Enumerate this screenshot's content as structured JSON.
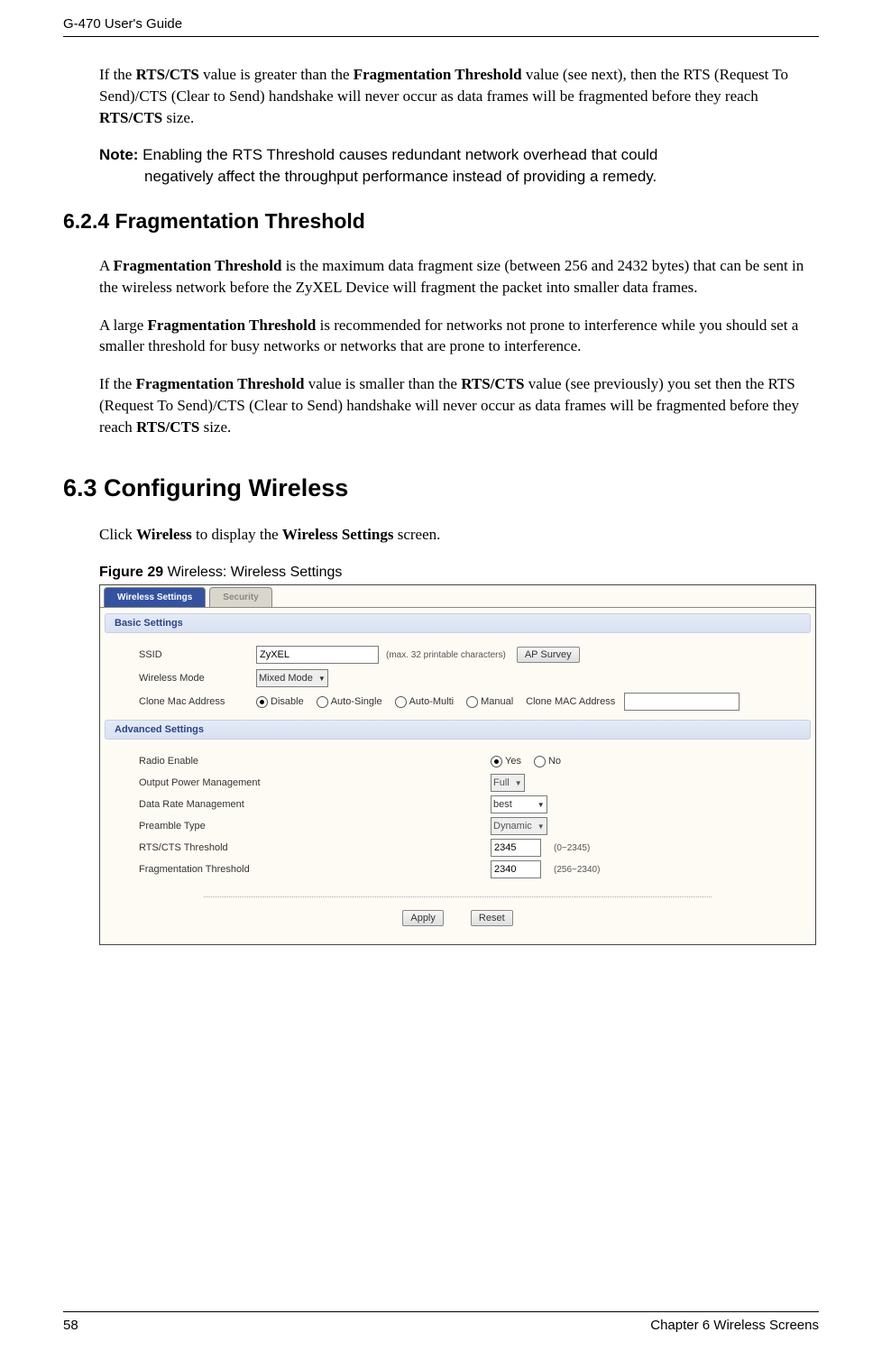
{
  "header": {
    "guide_title": "G-470 User's Guide"
  },
  "body": {
    "p1_pre": "If the ",
    "p1_b1": "RTS/CTS",
    "p1_mid1": " value is greater than the ",
    "p1_b2": "Fragmentation Threshold",
    "p1_mid2": " value (see next), then the RTS (Request To Send)/CTS (Clear to Send) handshake will never occur as data frames will be fragmented before they reach ",
    "p1_b3": "RTS/CTS",
    "p1_post": " size.",
    "note_label": "Note:",
    "note_line1": " Enabling the RTS Threshold causes redundant network overhead that could",
    "note_line2": "negatively affect the throughput performance instead of providing a remedy.",
    "h_6_2_4": "6.2.4  Fragmentation Threshold",
    "p2_pre": "A ",
    "p2_b1": "Fragmentation Threshold",
    "p2_post": " is the maximum data fragment size (between 256 and 2432 bytes) that can be sent in the wireless network before the ZyXEL Device will fragment the packet into smaller data frames.",
    "p3_pre": "A large ",
    "p3_b1": "Fragmentation Threshold",
    "p3_post": " is recommended for networks not prone to interference while you should set a smaller threshold for busy networks or networks that are prone to interference.",
    "p4_pre": "If the ",
    "p4_b1": "Fragmentation Threshold",
    "p4_mid1": " value is smaller than the ",
    "p4_b2": "RTS/CTS",
    "p4_mid2": " value (see previously) you set then the RTS (Request To Send)/CTS (Clear to Send) handshake will never occur as data frames will be fragmented before they reach ",
    "p4_b3": "RTS/CTS",
    "p4_post": " size.",
    "h_6_3": "6.3  Configuring Wireless",
    "click_pre": "Click ",
    "click_b1": "Wireless",
    "click_mid": " to display the ",
    "click_b2": "Wireless Settings",
    "click_post": " screen.",
    "figure_label": "Figure 29   ",
    "figure_title": "Wireless: Wireless Settings"
  },
  "screenshot": {
    "tabs": {
      "active": "Wireless Settings",
      "inactive": "Security"
    },
    "basic": {
      "title": "Basic Settings",
      "ssid_label": "SSID",
      "ssid_value": "ZyXEL",
      "ssid_hint": "(max. 32 printable characters)",
      "ap_survey": "AP Survey",
      "mode_label": "Wireless Mode",
      "mode_value": "Mixed Mode",
      "clone_label": "Clone Mac Address",
      "clone_opts": {
        "disable": "Disable",
        "auto_single": "Auto-Single",
        "auto_multi": "Auto-Multi",
        "manual": "Manual"
      },
      "clone_mac_label": "Clone MAC Address"
    },
    "advanced": {
      "title": "Advanced Settings",
      "radio_enable": "Radio Enable",
      "yes": "Yes",
      "no": "No",
      "output_power": "Output Power Management",
      "output_power_val": "Full",
      "data_rate": "Data Rate Management",
      "data_rate_val": "best",
      "preamble": "Preamble Type",
      "preamble_val": "Dynamic",
      "rts": "RTS/CTS Threshold",
      "rts_val": "2345",
      "rts_hint": "(0~2345)",
      "frag": "Fragmentation Threshold",
      "frag_val": "2340",
      "frag_hint": "(256~2340)"
    },
    "buttons": {
      "apply": "Apply",
      "reset": "Reset"
    }
  },
  "footer": {
    "page": "58",
    "chapter": "Chapter 6 Wireless Screens"
  }
}
